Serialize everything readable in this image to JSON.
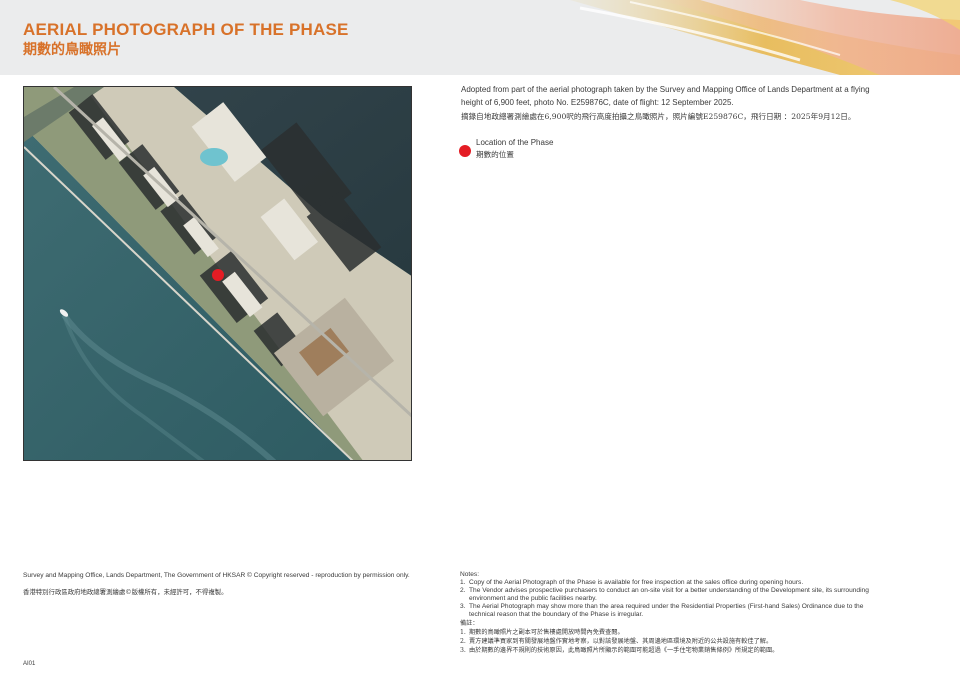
{
  "header": {
    "title_en": "AERIAL PHOTOGRAPH OF THE PHASE",
    "title_zh": "期數的鳥瞰照片",
    "accent_color": "#d8722a"
  },
  "photo": {
    "description_icon": "aerial-photo",
    "marker_color": "#e41c24"
  },
  "caption": {
    "en": "Adopted from part of the aerial photograph taken by the Survey and Mapping Office of Lands Department at a flying height of 6,900 feet, photo No. E259876C, date of flight: 12 September 2025.",
    "zh": "摘錄自地政總署測繪處在6,900呎的飛行高度拍攝之鳥瞰照片，照片編號E259876C，飛行日期 ：2025年9月12日。"
  },
  "legend": {
    "en": "Location of the Phase",
    "zh": "期數的位置"
  },
  "copyright": {
    "en": "Survey and Mapping Office, Lands Department, The Government of HKSAR © Copyright reserved - reproduction by permission only.",
    "zh": "香港特別行政區政府地政總署測繪處©版權所有，未經許可，不得複製。"
  },
  "page_code": "AI01",
  "notes": {
    "heading_en": "Notes:",
    "items_en": [
      {
        "num": "1.",
        "text": "Copy of the Aerial Photograph of the Phase is available for free inspection at the sales office during opening hours."
      },
      {
        "num": "2.",
        "text": "The Vendor advises prospective purchasers to conduct an on-site visit for a better understanding of the Development site, its surrounding environment and the public facilities nearby."
      },
      {
        "num": "3.",
        "text": "The Aerial Photograph may show more than the area required under the Residential Properties (First-hand Sales) Ordinance due to the technical reason that the boundary of the Phase is irregular."
      }
    ],
    "heading_zh": "備註：",
    "items_zh": [
      {
        "num": "1.",
        "text": "期數的鳥瞰照片之副本可於售樓處開放時間內免費查閱。"
      },
      {
        "num": "2.",
        "text": "賣方建議準買家到有關發展地盤作實地考察，以對該發展地盤、其周邊地區環境及附近的公共設施有較佳了解。"
      },
      {
        "num": "3.",
        "text": "由於期數的邊界不規則的技術原因，此鳥瞰照片所顯示的範圍可能超過《一手住宅物業銷售條例》所規定的範圍。"
      }
    ]
  }
}
